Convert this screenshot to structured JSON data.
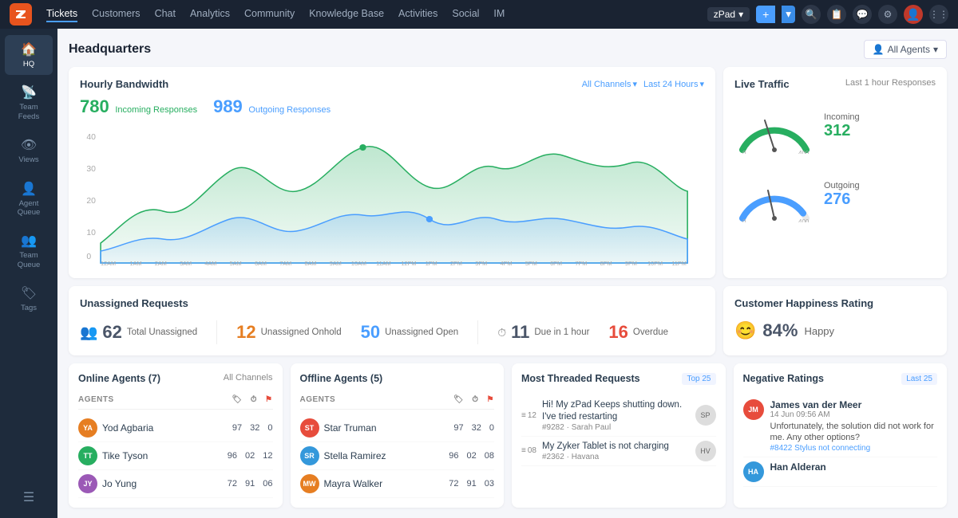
{
  "topnav": {
    "logo": "Z",
    "items": [
      {
        "label": "Tickets",
        "active": true
      },
      {
        "label": "Customers"
      },
      {
        "label": "Chat"
      },
      {
        "label": "Analytics"
      },
      {
        "label": "Community"
      },
      {
        "label": "Knowledge Base"
      },
      {
        "label": "Activities"
      },
      {
        "label": "Social"
      },
      {
        "label": "IM"
      }
    ],
    "zpad": "zPad",
    "plus": "+",
    "more": "≡"
  },
  "sidebar": {
    "items": [
      {
        "label": "HQ",
        "icon": "🏠",
        "active": true
      },
      {
        "label": "Team Feeds",
        "icon": "📡"
      },
      {
        "label": "Views",
        "icon": "👁"
      },
      {
        "label": "Agent Queue",
        "icon": "👤"
      },
      {
        "label": "Team Queue",
        "icon": "👥"
      },
      {
        "label": "Tags",
        "icon": "🏷"
      }
    ],
    "bottom_icon": "≡"
  },
  "page": {
    "title": "Headquarters",
    "all_agents_label": "All Agents"
  },
  "bandwidth": {
    "title": "Hourly Bandwidth",
    "incoming_value": "780",
    "incoming_label": "Incoming Responses",
    "outgoing_value": "989",
    "outgoing_label": "Outgoing Responses",
    "filter_channels": "All Channels",
    "filter_time": "Last 24 Hours"
  },
  "live_traffic": {
    "title": "Live Traffic",
    "subtitle": "Last 1 hour Responses",
    "incoming_label": "Incoming",
    "incoming_value": "312",
    "outgoing_label": "Outgoing",
    "outgoing_value": "276",
    "gauge_max": "400",
    "gauge_min": "0"
  },
  "unassigned": {
    "title": "Unassigned Requests",
    "total_num": "62",
    "total_label": "Total Unassigned",
    "onhold_num": "12",
    "onhold_label": "Unassigned Onhold",
    "open_num": "50",
    "open_label": "Unassigned Open",
    "due_num": "11",
    "due_label": "Due in 1 hour",
    "overdue_num": "16",
    "overdue_label": "Overdue"
  },
  "happiness": {
    "title": "Customer Happiness Rating",
    "percentage": "84%",
    "label": "Happy"
  },
  "online_agents": {
    "title": "Online Agents (7)",
    "channel": "All Channels",
    "col_agents": "AGENTS",
    "agents": [
      {
        "name": "Yod Agbaria",
        "s1": "97",
        "s2": "32",
        "s3": "0",
        "color": "#e67e22"
      },
      {
        "name": "Tike Tyson",
        "s1": "96",
        "s2": "02",
        "s3": "12",
        "color": "#27ae60"
      },
      {
        "name": "Jo Yung",
        "s1": "72",
        "s2": "91",
        "s3": "06",
        "color": "#9b59b6"
      }
    ]
  },
  "offline_agents": {
    "title": "Offline Agents (5)",
    "col_agents": "AGENTS",
    "agents": [
      {
        "name": "Star Truman",
        "s1": "97",
        "s2": "32",
        "s3": "0",
        "color": "#e74c3c"
      },
      {
        "name": "Stella Ramirez",
        "s1": "96",
        "s2": "02",
        "s3": "08",
        "color": "#3498db"
      },
      {
        "name": "Mayra Walker",
        "s1": "72",
        "s2": "91",
        "s3": "03",
        "color": "#e67e22"
      }
    ]
  },
  "threaded": {
    "title": "Most Threaded Requests",
    "badge": "Top 25",
    "requests": [
      {
        "rank": "12",
        "msg": "Hi! My zPad Keeps shutting down. I've tried restarting",
        "ticket": "#9282",
        "sub": "Sarah Paul"
      },
      {
        "rank": "08",
        "msg": "My Zyker Tablet is not charging",
        "ticket": "#2362",
        "sub": "Havana"
      }
    ]
  },
  "negative": {
    "title": "Negative Ratings",
    "badge": "Last 25",
    "ratings": [
      {
        "name": "James van der Meer",
        "date": "14 Jun 09:56 AM",
        "msg": "Unfortunately, the solution did not work for me. Any other options?",
        "ticket": "#8422 Stylus not connecting",
        "color": "#e74c3c"
      },
      {
        "name": "Han Alderan",
        "date": "",
        "msg": "",
        "ticket": "",
        "color": "#3498db"
      }
    ]
  },
  "colors": {
    "green": "#27ae60",
    "blue": "#4a9eff",
    "orange": "#e67e22",
    "red": "#e74c3c",
    "sidebar_bg": "#1e2b3c",
    "nav_bg": "#1a2332"
  }
}
